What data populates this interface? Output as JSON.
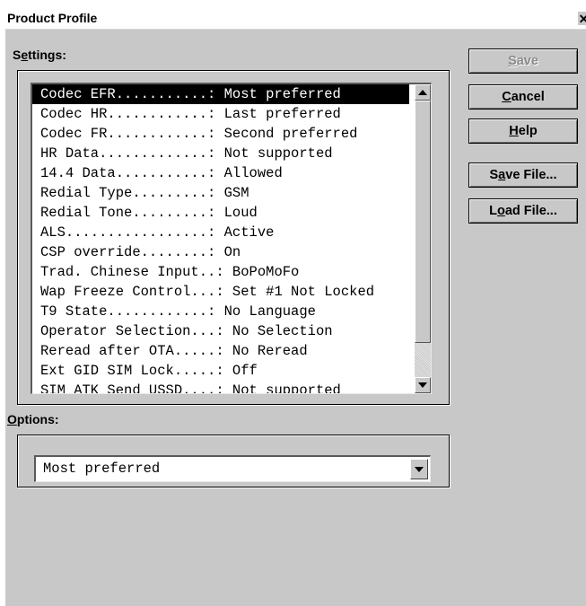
{
  "window": {
    "title": "Product Profile",
    "close_glyph": "✕"
  },
  "settings": {
    "label_prefix": "S",
    "label_accel": "e",
    "label_suffix": "ttings:",
    "items": [
      "Codec EFR...........: Most preferred",
      "Codec HR............: Last preferred",
      "Codec FR............: Second preferred",
      "HR Data.............: Not supported",
      "14.4 Data...........: Allowed",
      "Redial Type.........: GSM",
      "Redial Tone.........: Loud",
      "ALS.................: Active",
      "CSP override........: On",
      "Trad. Chinese Input..: BoPoMoFo",
      "Wap Freeze Control...: Set #1 Not Locked",
      "T9 State............: No Language",
      "Operator Selection...: No Selection",
      "Reread after OTA.....: No Reread",
      "Ext GID SIM Lock.....: Off",
      "SIM ATK Send USSD....: Not supported"
    ],
    "selected_index": 0
  },
  "options": {
    "label_accel": "O",
    "label_suffix": "ptions:",
    "selected_value": "Most preferred"
  },
  "buttons": {
    "save": {
      "accel": "S",
      "rest": "ave",
      "disabled": true
    },
    "cancel": {
      "accel": "C",
      "rest": "ancel"
    },
    "help": {
      "accel": "H",
      "rest": "elp"
    },
    "save_file": {
      "pre": "S",
      "accel": "a",
      "rest": "ve File..."
    },
    "load_file": {
      "pre": "L",
      "accel": "o",
      "rest": "ad File..."
    }
  },
  "colors": {
    "dialog_bg": "#c8c8c8",
    "selection_bg": "#000000",
    "selection_fg": "#ffffff",
    "disabled_text": "#8a8a8a"
  },
  "icons": {
    "close": "close-icon",
    "scroll_up": "scroll-up-arrow-icon",
    "scroll_down": "scroll-down-arrow-icon",
    "dropdown": "chevron-down-icon"
  }
}
